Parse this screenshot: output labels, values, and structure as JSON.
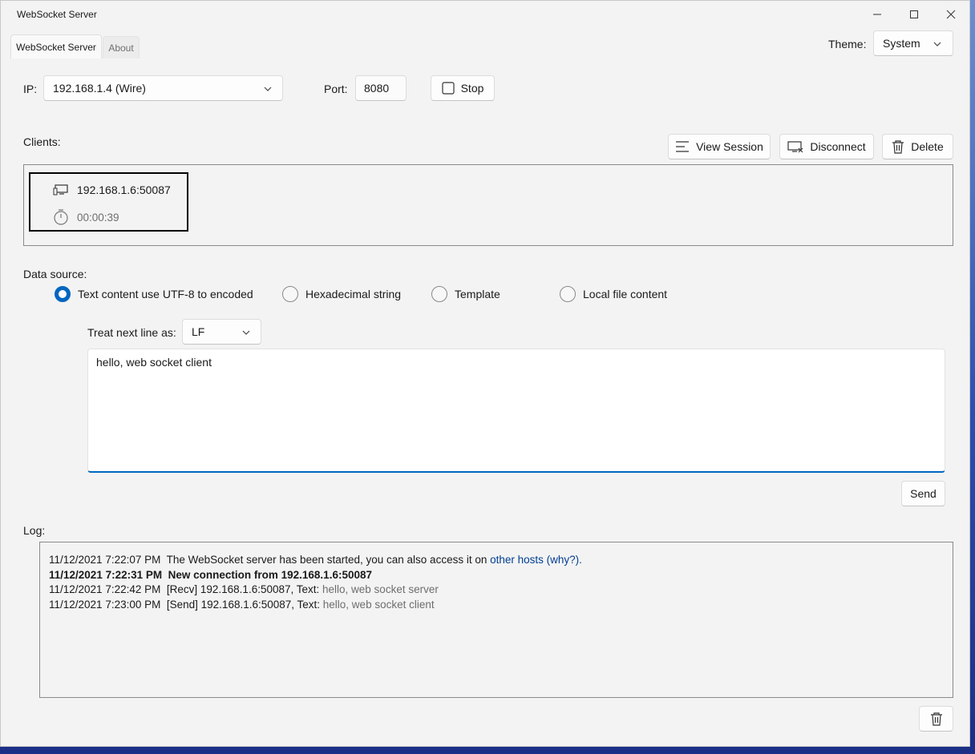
{
  "window": {
    "title": "WebSocket Server"
  },
  "tabs": [
    {
      "label": "WebSocket Server"
    },
    {
      "label": "About"
    }
  ],
  "theme": {
    "label": "Theme:",
    "value": "System"
  },
  "server": {
    "ip_label": "IP:",
    "ip_value": "192.168.1.4 (Wire)",
    "port_label": "Port:",
    "port_value": "8080",
    "stop_label": "Stop"
  },
  "clients": {
    "label": "Clients:",
    "view_session": "View Session",
    "disconnect": "Disconnect",
    "delete": "Delete",
    "items": [
      {
        "address": "192.168.1.6:50087",
        "duration": "00:00:39"
      }
    ]
  },
  "data_source": {
    "label": "Data source:",
    "options": [
      {
        "label": "Text content use UTF-8 to encoded",
        "selected": true
      },
      {
        "label": "Hexadecimal string",
        "selected": false
      },
      {
        "label": "Template",
        "selected": false
      },
      {
        "label": "Local file content",
        "selected": false
      }
    ],
    "next_line_label": "Treat next line as:",
    "next_line_value": "LF",
    "message": "hello, web socket client",
    "send": "Send"
  },
  "log": {
    "label": "Log:",
    "entries": [
      {
        "time": "11/12/2021 7:22:07 PM",
        "text": "The WebSocket server has been started, you can also access it on ",
        "link": "other hosts (why?)."
      },
      {
        "time": "11/12/2021 7:22:31 PM",
        "text": "New connection from 192.168.1.6:50087"
      },
      {
        "time": "11/12/2021 7:22:42 PM",
        "text": "[Recv] 192.168.1.6:50087, Text: ",
        "payload": "hello, web socket server"
      },
      {
        "time": "11/12/2021 7:23:00 PM",
        "text": "[Send] 192.168.1.6:50087, Text: ",
        "payload": "hello, web socket client"
      }
    ]
  },
  "colors": {
    "accent": "#0067c0",
    "link": "#003e92"
  }
}
